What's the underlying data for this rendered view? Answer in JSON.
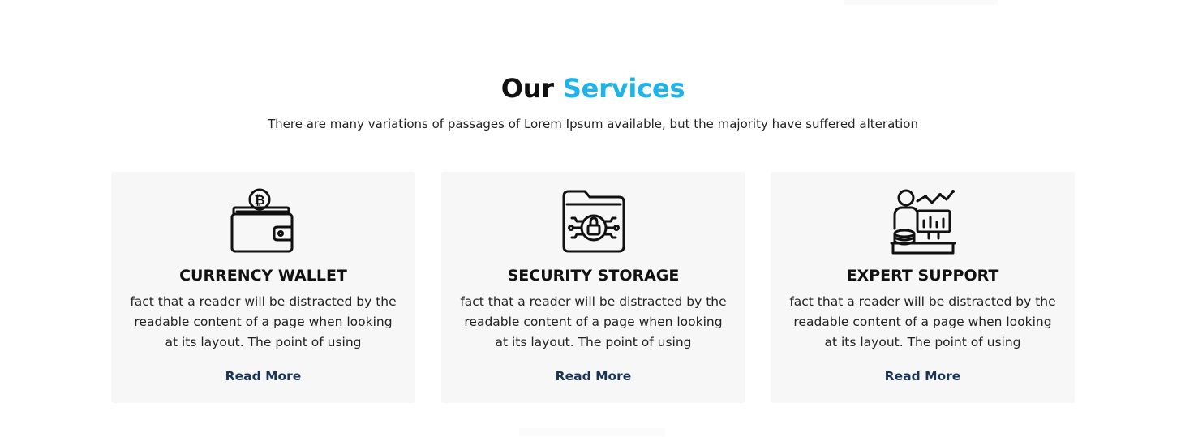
{
  "section": {
    "heading_plain": "Our",
    "heading_accent": "Services",
    "subtitle": "There are many variations of passages of Lorem Ipsum available, but the majority have suffered alteration",
    "accent_color": "#1fb4e9"
  },
  "cards": [
    {
      "icon": "bitcoin-wallet-icon",
      "title": "CURRENCY WALLET",
      "description": "fact that a reader will be distracted by the readable content of a page when looking at its layout. The point of using",
      "link": "Read More"
    },
    {
      "icon": "secure-folder-lock-icon",
      "title": "SECURITY STORAGE",
      "description": "fact that a reader will be distracted by the readable content of a page when looking at its layout. The point of using",
      "link": "Read More"
    },
    {
      "icon": "expert-analytics-support-icon",
      "title": "EXPERT SUPPORT",
      "description": "fact that a reader will be distracted by the readable content of a page when looking at its layout. The point of using",
      "link": "Read More"
    }
  ],
  "colors": {
    "card_background": "#f7f7f7",
    "link_color": "#1b3558"
  }
}
